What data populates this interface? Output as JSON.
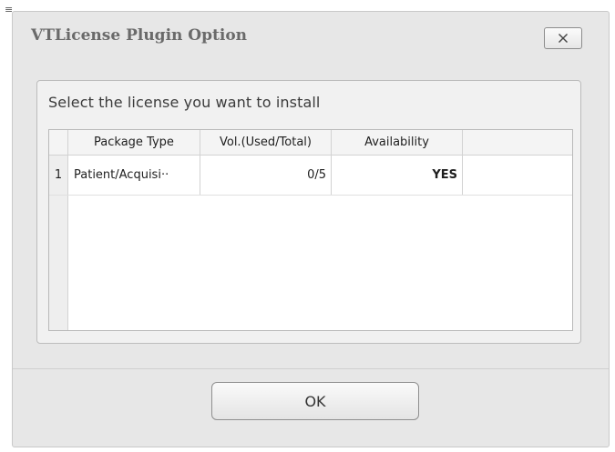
{
  "window": {
    "title": "VTLicense Plugin Option",
    "close_label": "X"
  },
  "panel": {
    "prompt": "Select the license you want to install"
  },
  "table": {
    "columns": [
      "Package Type",
      "Vol.(Used/Total)",
      "Availability"
    ],
    "rows": [
      {
        "index": "1",
        "package_type": "Patient/Acquisi··",
        "volume": "0/5",
        "availability": "YES"
      }
    ]
  },
  "footer": {
    "ok_label": "OK"
  }
}
